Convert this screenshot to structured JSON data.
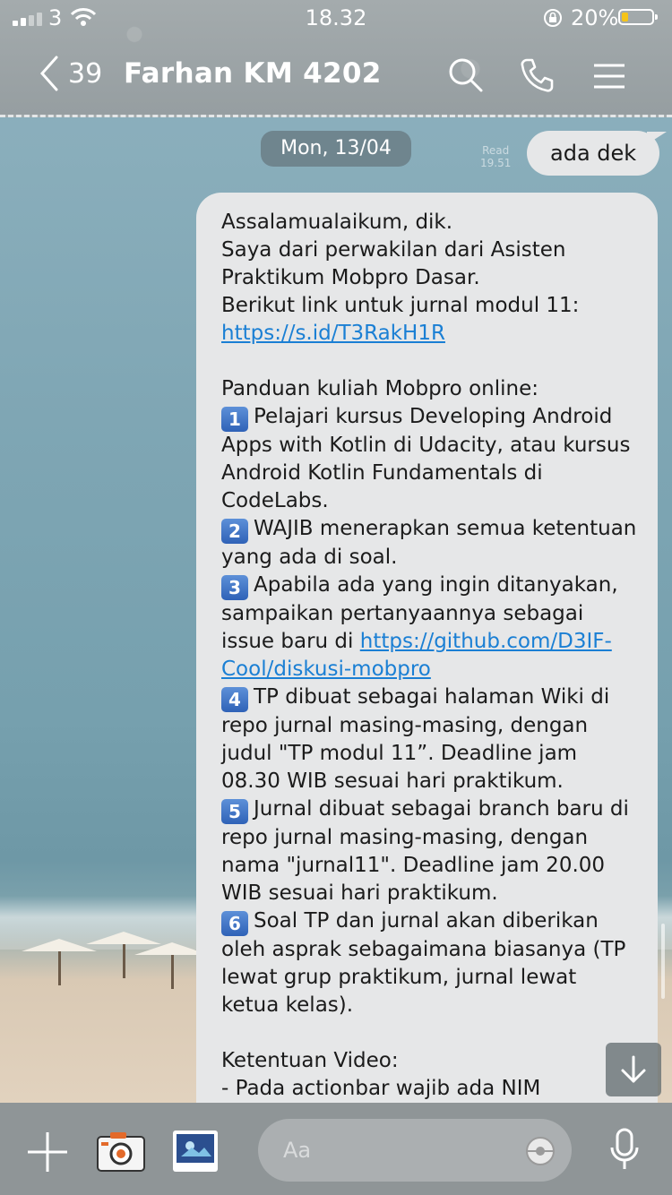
{
  "status_bar": {
    "carrier": "3",
    "time": "18.32",
    "battery": "20%"
  },
  "header": {
    "back_count": "39",
    "title": "Farhan KM 4202"
  },
  "chat": {
    "date": "Mon, 13/04",
    "read_label": "Read",
    "read_time": "19.51",
    "outgoing_message": "ada dek",
    "incoming": {
      "line_1": "Assalamualaikum, dik.",
      "line_2": "Saya dari perwakilan dari Asisten",
      "line_3": "Praktikum Mobpro Dasar.",
      "line_4": "Berikut link untuk jurnal modul 11:",
      "link_1": "https://s.id/T3RakH1R",
      "guide_title": "Panduan kuliah Mobpro online:",
      "item_1": "Pelajari kursus Developing Android Apps with Kotlin di Udacity, atau kursus Android Kotlin Fundamentals di CodeLabs.",
      "item_2": "WAJIB menerapkan semua ketentuan yang ada di soal.",
      "item_3": "Apabila ada yang ingin ditanyakan, sampaikan pertanyaannya sebagai issue baru di",
      "link_2": "https://github.com/D3IF-Cool/diskusi-mobpro",
      "item_4": "TP dibuat sebagai halaman Wiki di repo jurnal masing-masing, dengan judul \"TP modul 11”. Deadline jam 08.30 WIB sesuai hari praktikum.",
      "item_5": "Jurnal dibuat sebagai branch baru di repo jurnal masing-masing, dengan nama \"jurnal11\". Deadline jam 20.00 WIB sesuai hari praktikum.",
      "item_6": "Soal TP dan jurnal akan diberikan oleh asprak sebagaimana biasanya (TP lewat grup praktikum, jurnal lewat ketua kelas).",
      "video_title": "Ketentuan Video:",
      "video_item_1": "- Pada actionbar wajib ada NIM",
      "numbers": [
        "1",
        "2",
        "3",
        "4",
        "5",
        "6"
      ]
    }
  },
  "input": {
    "placeholder": "Aa"
  },
  "colors": {
    "link": "#1a7fd4",
    "bubble": "#e6e7e8",
    "battery_fill": "#f5c419"
  }
}
